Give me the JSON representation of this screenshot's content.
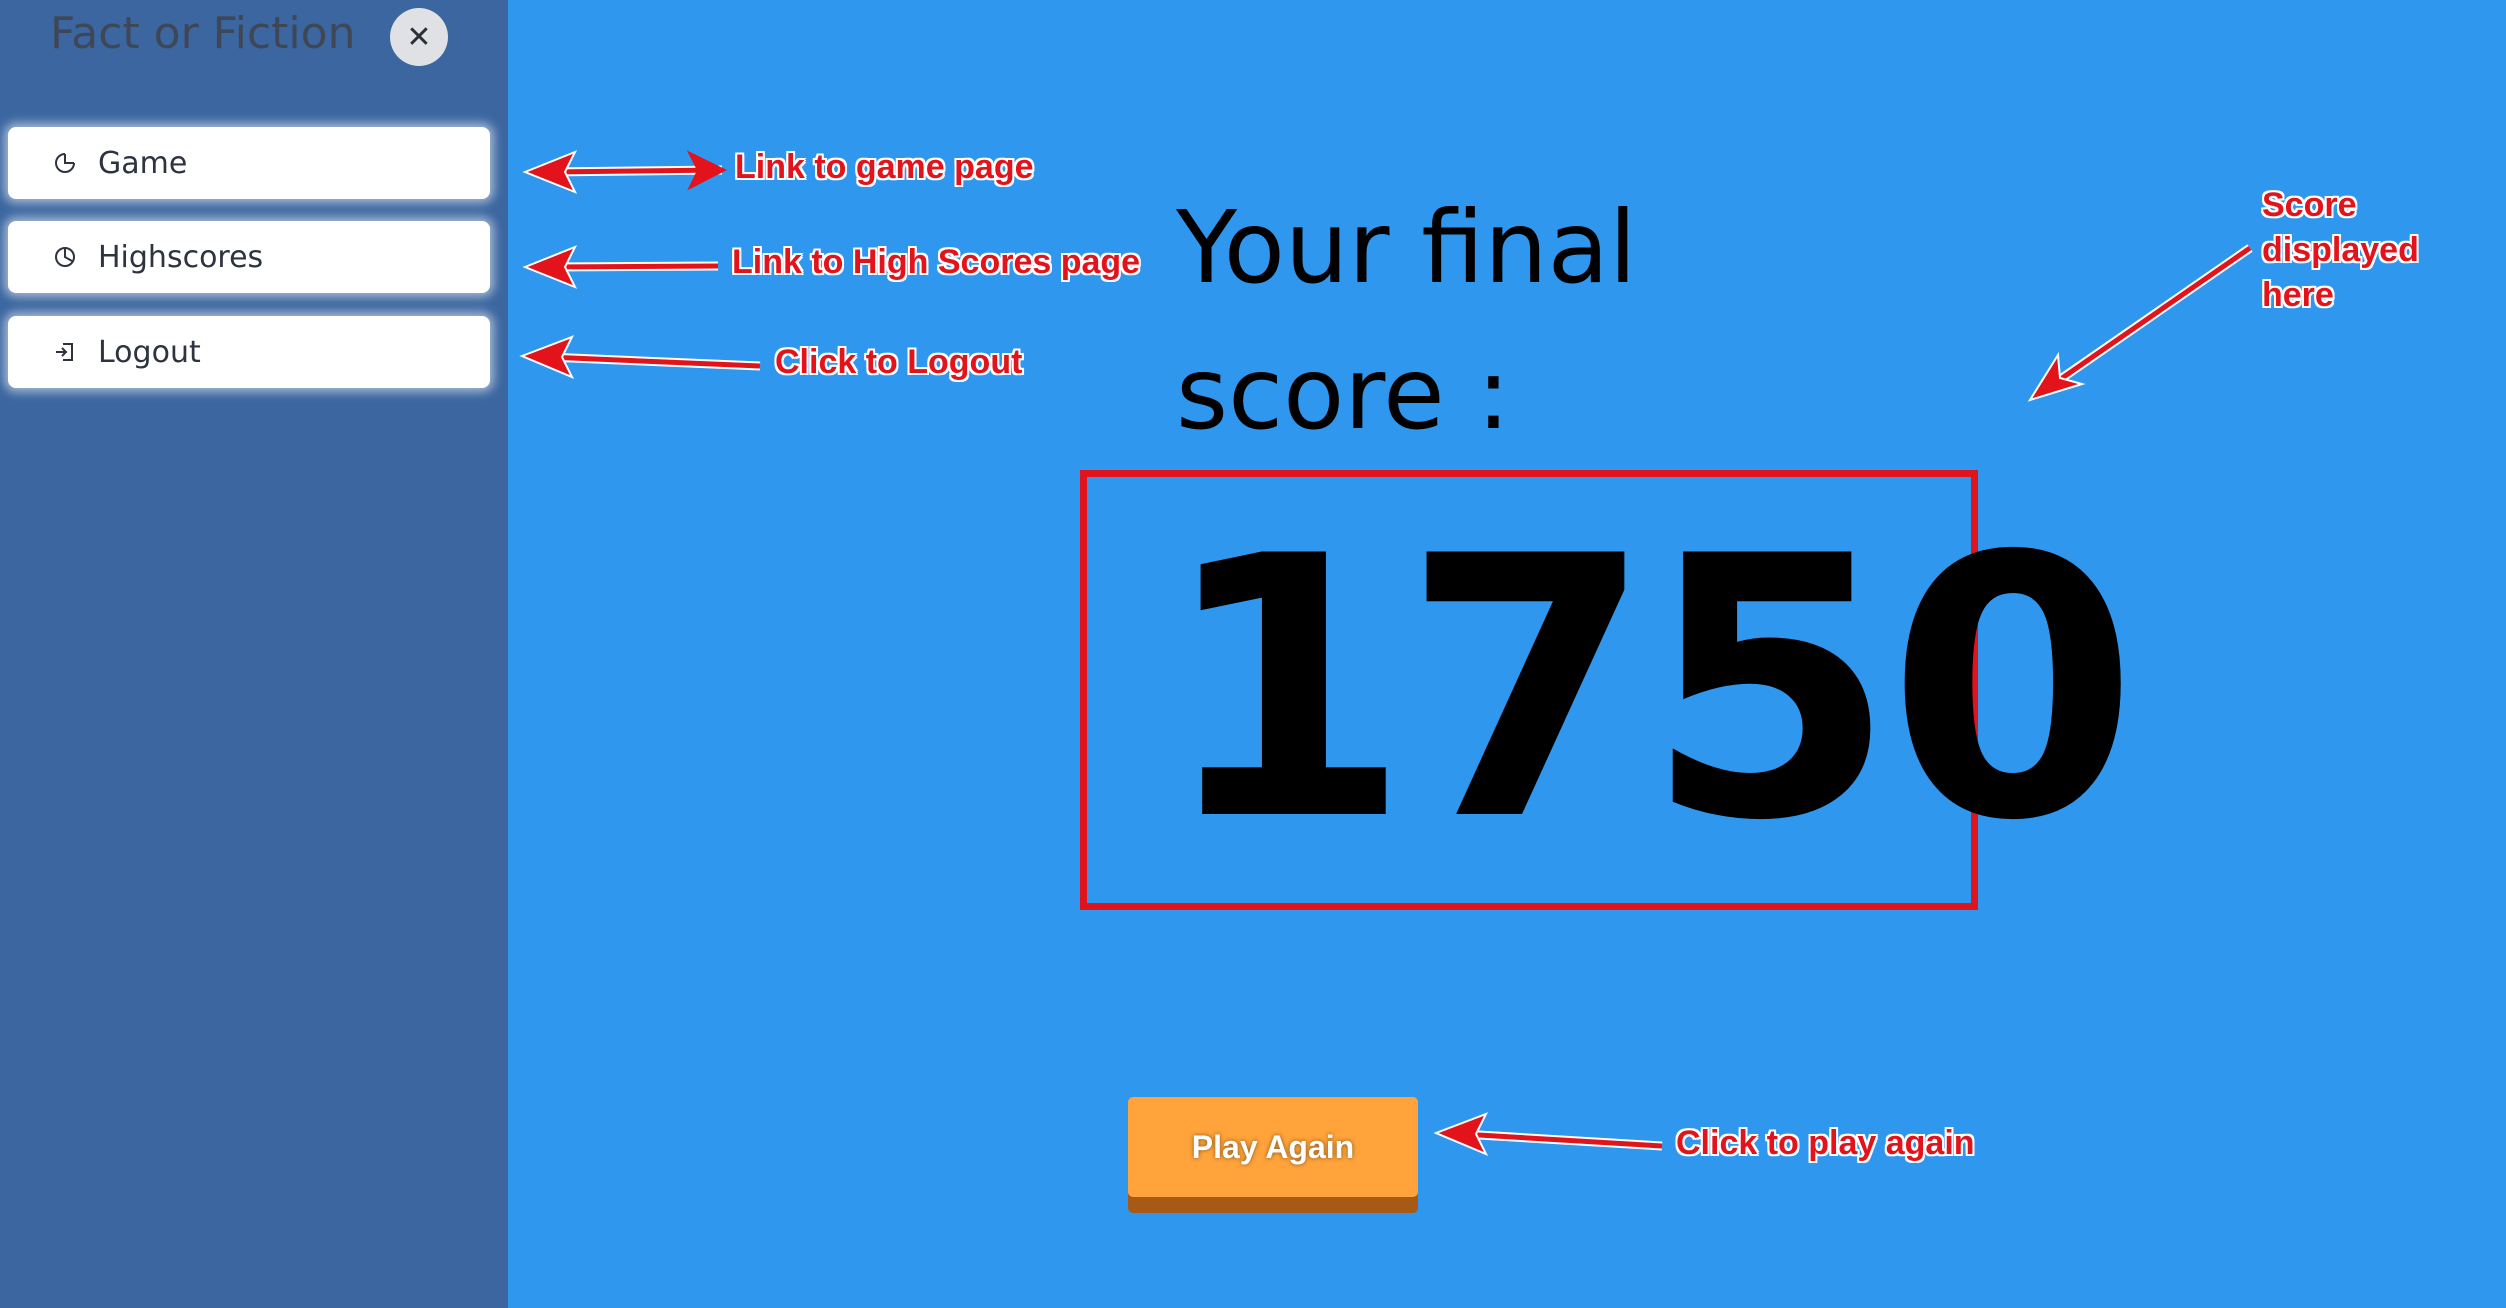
{
  "app": {
    "title": "Fact or Fiction",
    "close_icon": "close-icon"
  },
  "sidebar": {
    "items": [
      {
        "label": "Game",
        "icon": "pie-chart-icon"
      },
      {
        "label": "Highscores",
        "icon": "clock-pie-icon"
      },
      {
        "label": "Logout",
        "icon": "logout-icon"
      }
    ]
  },
  "main": {
    "final_label_line1": "Your final",
    "final_label_line2": "score :",
    "score": "1750",
    "play_again_label": "Play Again"
  },
  "annotations": {
    "game": "Link to game page",
    "highscores": "Link to High Scores page",
    "logout": "Click to Logout",
    "score_line1": "Score",
    "score_line2": "displayed",
    "score_line3": "here",
    "play_again": "Click to play again"
  },
  "colors": {
    "background": "#2f97ee",
    "sidebar": "#3b66a0",
    "accent_button": "#ffa33a",
    "annotation": "#e3131b",
    "score_border": "#e0141c"
  }
}
